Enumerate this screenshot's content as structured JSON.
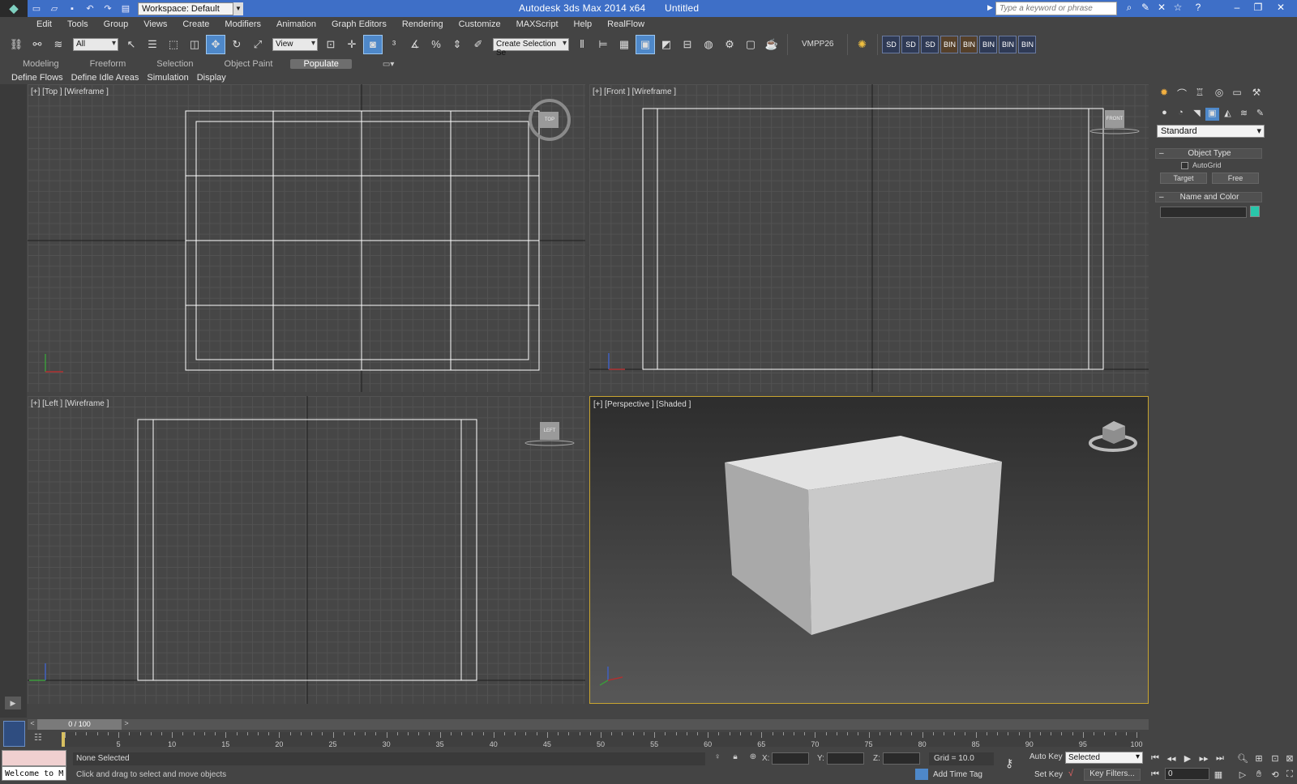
{
  "titlebar": {
    "workspace": "Workspace: Default",
    "app_title": "Autodesk 3ds Max  2014 x64",
    "doc_title": "Untitled",
    "search_placeholder": "Type a keyword or phrase"
  },
  "menu": [
    "Edit",
    "Tools",
    "Group",
    "Views",
    "Create",
    "Modifiers",
    "Animation",
    "Graph Editors",
    "Rendering",
    "Customize",
    "MAXScript",
    "Help",
    "RealFlow"
  ],
  "toolbar": {
    "selection_filter": "All",
    "reference_coord": "View",
    "named_selection_placeholder": "Create Selection Se",
    "vmpp_label": "VMPP26"
  },
  "ribbon": {
    "tabs": [
      "Modeling",
      "Freeform",
      "Selection",
      "Object Paint",
      "Populate"
    ],
    "active_tab": "Populate",
    "sub_items": [
      "Define Flows",
      "Define Idle Areas",
      "Simulation",
      "Display"
    ]
  },
  "viewports": {
    "top": {
      "label": "[+] [Top ] [Wireframe ]",
      "viewcube": "TOP"
    },
    "front": {
      "label": "[+] [Front ] [Wireframe ]",
      "viewcube": "FRONT"
    },
    "left": {
      "label": "[+] [Left ] [Wireframe ]",
      "viewcube": "LEFT"
    },
    "perspective": {
      "label": "[+] [Perspective ] [Shaded ]"
    }
  },
  "command_panel": {
    "category": "Standard",
    "object_type_title": "Object Type",
    "autogrid_label": "AutoGrid",
    "buttons": [
      "Target",
      "Free"
    ],
    "name_color_title": "Name and Color",
    "swatch_color": "#29c6aa"
  },
  "timeline": {
    "slider_text": "0 / 100",
    "ticks": [
      5,
      10,
      15,
      20,
      25,
      30,
      35,
      40,
      45,
      50,
      55,
      60,
      65,
      70,
      75,
      80,
      85,
      90,
      95,
      100
    ]
  },
  "status": {
    "maxscript_text": "Welcome to M",
    "selection": "None Selected",
    "prompt": "Click and drag to select and move objects",
    "x_label": "X:",
    "y_label": "Y:",
    "z_label": "Z:",
    "grid": "Grid = 10.0",
    "add_time_tag": "Add Time Tag",
    "auto_key": "Auto Key",
    "set_key": "Set Key",
    "key_mode": "Selected",
    "key_filters": "Key Filters...",
    "current_frame": "0"
  }
}
